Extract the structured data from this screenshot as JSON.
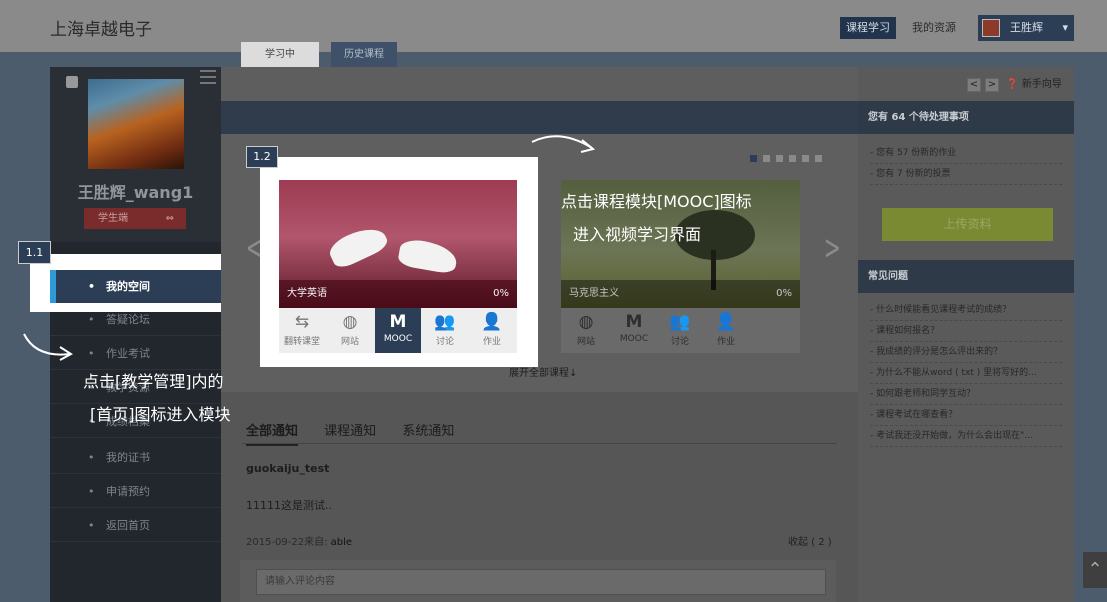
{
  "header": {
    "brand": "上海卓越电子",
    "nav_study": "课程学习",
    "nav_resources": "我的资源",
    "user_name": "王胜辉",
    "dropdown_icon": "chevron-down-icon"
  },
  "sidebar": {
    "username": "王胜辉_wang1",
    "role": "学生端",
    "role_switch_icon": "⇔",
    "items": [
      {
        "label": "我的空间",
        "active": true
      },
      {
        "label": "答疑论坛"
      },
      {
        "label": "作业考试"
      },
      {
        "label": "教学资源"
      },
      {
        "label": "成绩档案"
      },
      {
        "label": "我的证书"
      },
      {
        "label": "申请预约"
      },
      {
        "label": "返回首页"
      }
    ]
  },
  "tabs": {
    "studying": "学习中",
    "history": "历史课程"
  },
  "courses": [
    {
      "name": "大学英语",
      "progress": "0%",
      "icons": [
        {
          "glyph": "⇆",
          "label": "翻转课堂",
          "icon": "flip-classroom-icon"
        },
        {
          "glyph": "◍",
          "label": "网站",
          "icon": "globe-icon"
        },
        {
          "glyph": "M",
          "label": "MOOC",
          "icon": "mooc-icon",
          "active": true
        },
        {
          "glyph": "👥",
          "label": "讨论",
          "icon": "discussion-icon"
        },
        {
          "glyph": "👤",
          "label": "作业",
          "icon": "homework-icon"
        }
      ]
    },
    {
      "name": "马克思主义",
      "progress": "0%",
      "icons": [
        {
          "glyph": "◍",
          "label": "网站",
          "icon": "globe-icon"
        },
        {
          "glyph": "M",
          "label": "MOOC",
          "icon": "mooc-icon"
        },
        {
          "glyph": "👥",
          "label": "讨论",
          "icon": "discussion-icon"
        },
        {
          "glyph": "👤",
          "label": "作业",
          "icon": "homework-icon"
        }
      ]
    }
  ],
  "carousel": {
    "expand_all": "展开全部课程↓",
    "prev_glyph": "<",
    "next_glyph": ">"
  },
  "annotations": {
    "step_12": "1.2",
    "step_11": "1.1",
    "mooc_hint_line1": "点击课程模块[MOOC]图标",
    "mooc_hint_line2": "进入视频学习界面",
    "nav_hint_line1": "点击[教学管理]内的",
    "nav_hint_line2": "[首页]图标进入模块"
  },
  "notices": {
    "tabs": [
      "全部通知",
      "课程通知",
      "系统通知"
    ],
    "poster": "guokaiju_test",
    "message": "11111这是测试..",
    "date_prefix": "2015-09-22来自: ",
    "author": "able",
    "collapse": "收起 ( 2 )",
    "comment_placeholder": "请输入评论内容"
  },
  "right_panel": {
    "pager_prev": "<",
    "pager_next": ">",
    "guide": "新手向导",
    "pending_title": "您有 64 个待处理事项",
    "pending_items": [
      "- 您有 57 份新的作业",
      "- 您有 7 份新的投票"
    ],
    "upload": "上传资料",
    "faq_title": "常见问题",
    "faq_items": [
      "- 什么时候能看见课程考试的成绩？",
      "- 课程如何报名？",
      "- 我成绩的评分是怎么评出来的？",
      "- 为什么不能从word ( txt ) 里将写好的...",
      "- 如何跟老师和同学互动？",
      "- 课程考试在哪查看？",
      "- 考试我还没开始做，为什么会出现在\"..."
    ]
  },
  "colors": {
    "accent": "#2c3e55",
    "highlight_bar": "#2e9bd6",
    "upload": "#7a8a33"
  }
}
